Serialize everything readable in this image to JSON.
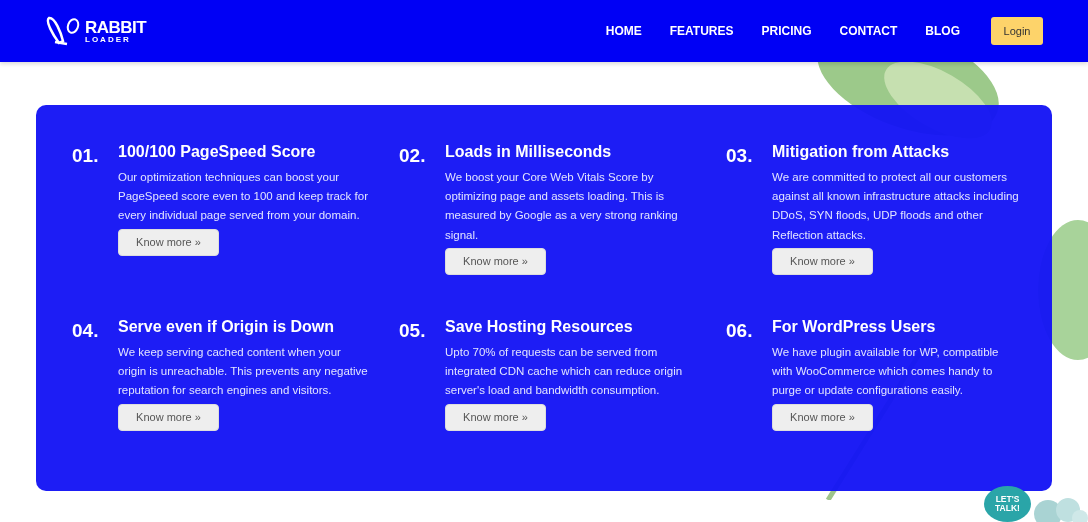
{
  "header": {
    "logo": {
      "line1": "RABBIT",
      "line2": "LOADER"
    },
    "nav": [
      {
        "label": "HOME"
      },
      {
        "label": "FEATURES"
      },
      {
        "label": "PRICING"
      },
      {
        "label": "CONTACT"
      },
      {
        "label": "BLOG"
      }
    ],
    "login": "Login"
  },
  "features": [
    {
      "number": "01.",
      "title": "100/100 PageSpeed Score",
      "text": "Our optimization techniques can boost your PageSpeed score even to 100 and keep track for every individual page served from your domain.",
      "button": "Know more »"
    },
    {
      "number": "02.",
      "title": "Loads in Milliseconds",
      "text": "We boost your Core Web Vitals Score by optimizing page and assets loading. This is measured by Google as a very strong ranking signal.",
      "button": "Know more »"
    },
    {
      "number": "03.",
      "title": "Mitigation from Attacks",
      "text": "We are committed to protect all our customers against all known infrastructure attacks including DDoS, SYN floods, UDP floods and other Reflection attacks.",
      "button": "Know more »"
    },
    {
      "number": "04.",
      "title": "Serve even if Origin is Down",
      "text": "We keep serving cached content when your origin is unreachable. This prevents any negative reputation for search engines and visitors.",
      "button": "Know more »"
    },
    {
      "number": "05.",
      "title": "Save Hosting Resources",
      "text": "Upto 70% of requests can be served from integrated CDN cache which can reduce origin server's load and bandwidth consumption.",
      "button": "Know more »"
    },
    {
      "number": "06.",
      "title": "For WordPress Users",
      "text": "We have plugin available for WP, compatible with WooCommerce which comes handy to purge or update configurations easily.",
      "button": "Know more »"
    }
  ],
  "chat": {
    "line1": "LET'S",
    "line2": "TALK!"
  }
}
